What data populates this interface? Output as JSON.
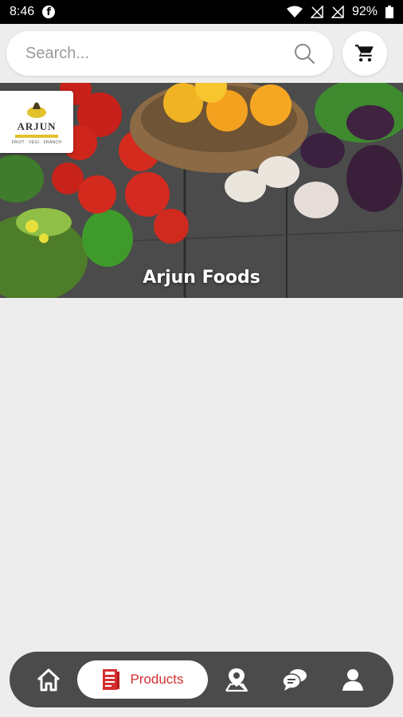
{
  "status_bar": {
    "time": "8:46",
    "battery": "92%",
    "icons": [
      "facebook-icon",
      "wifi-icon",
      "no-signal-icon",
      "no-signal-icon",
      "battery-icon"
    ]
  },
  "search": {
    "placeholder": "Search..."
  },
  "banner": {
    "caption": "Arjun Foods",
    "logo_text": "ARJUN",
    "logo_tagline": "FRUIT · VEGI · FRANCH",
    "logo_color": "#e2c12b"
  },
  "bottom_nav": {
    "items": [
      {
        "name": "home",
        "icon": "home-icon"
      },
      {
        "name": "products",
        "label": "Products",
        "icon": "catalog-icon",
        "active": true
      },
      {
        "name": "location",
        "icon": "map-pin-icon"
      },
      {
        "name": "chat",
        "icon": "chat-icon"
      },
      {
        "name": "profile",
        "icon": "user-icon"
      }
    ],
    "active_color": "#d32f2f",
    "background": "#4b4b4b"
  }
}
